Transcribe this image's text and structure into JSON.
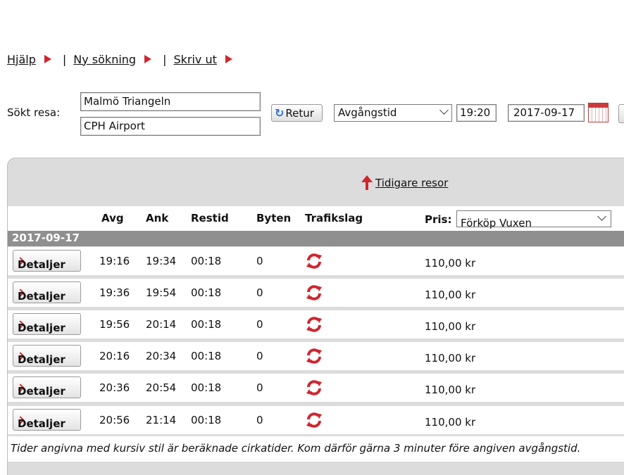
{
  "toplinks": {
    "help": "Hjälp",
    "new_search": "Ny sökning",
    "print": "Skriv ut"
  },
  "search": {
    "label": "Sökt resa:",
    "from": "Malmö Triangeln",
    "to": "CPH Airport",
    "return_label": "Retur",
    "time_mode": "Avgångstid",
    "time": "19:20",
    "date": "2017-09-17"
  },
  "earlier_label": "Tidigare resor",
  "columns": {
    "dep": "Avg",
    "arr": "Ank",
    "duration": "Restid",
    "changes": "Byten",
    "mode": "Trafikslag",
    "price": "Pris:"
  },
  "price_type": "Förköp Vuxen",
  "date_header": "2017-09-17",
  "details_label": "Detaljer",
  "trips": [
    {
      "dep": "19:16",
      "arr": "19:34",
      "duration": "00:18",
      "changes": "0",
      "price": "110,00 kr"
    },
    {
      "dep": "19:36",
      "arr": "19:54",
      "duration": "00:18",
      "changes": "0",
      "price": "110,00 kr"
    },
    {
      "dep": "19:56",
      "arr": "20:14",
      "duration": "00:18",
      "changes": "0",
      "price": "110,00 kr"
    },
    {
      "dep": "20:16",
      "arr": "20:34",
      "duration": "00:18",
      "changes": "0",
      "price": "110,00 kr"
    },
    {
      "dep": "20:36",
      "arr": "20:54",
      "duration": "00:18",
      "changes": "0",
      "price": "110,00 kr"
    },
    {
      "dep": "20:56",
      "arr": "21:14",
      "duration": "00:18",
      "changes": "0",
      "price": "110,00 kr"
    }
  ],
  "footer_note": "Tider angivna med kursiv stil är beräknade cirkatider. Kom därför gärna 3 minuter före angiven avgångstid.",
  "icons": {
    "mode": "train-icon"
  },
  "colors": {
    "accent": "#d0262e",
    "date_bar": "#8f8f8f"
  }
}
